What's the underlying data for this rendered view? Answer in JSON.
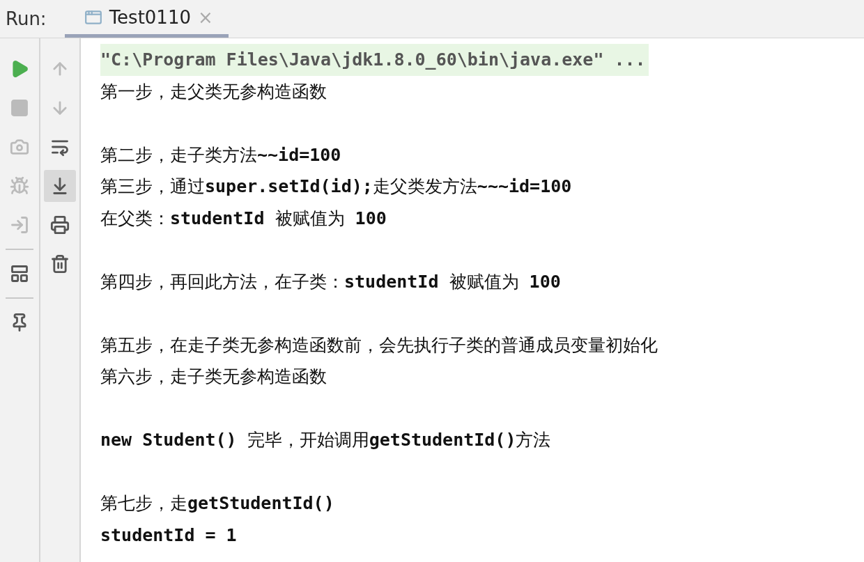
{
  "header": {
    "label": "Run:",
    "tab": {
      "title": "Test0110",
      "selected": true,
      "close": "×"
    }
  },
  "scroll_to_end": {
    "on": true
  },
  "console": {
    "command": "\"C:\\Program Files\\Java\\jdk1.8.0_60\\bin\\java.exe\" ...",
    "blocks": [
      [
        "第一步，走父类无参构造函数"
      ],
      [
        "第二步，走子类方法**~~id=100**",
        "第三步，通过**super.setId(id);**走父类发方法**~~~id=100**",
        "在父类：**studentId** 被赋值为 **100**"
      ],
      [
        "第四步，再回此方法，在子类：**studentId** 被赋值为 **100**"
      ],
      [
        "第五步，在走子类无参构造函数前，会先执行子类的普通成员变量初始化",
        "第六步，走子类无参构造函数"
      ],
      [
        "**new Student()** 完毕，开始调用**getStudentId()**方法"
      ],
      [
        "第七步，走**getStudentId()**",
        "**studentId = 1**"
      ]
    ]
  }
}
